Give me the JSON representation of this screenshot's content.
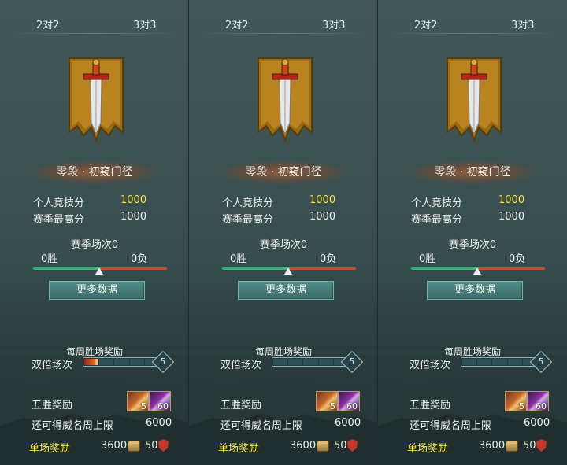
{
  "panels": [
    {
      "tabs": [
        "2对2",
        "3对3"
      ],
      "active_tab": 0,
      "rank": "零段 · 初窥门径",
      "personal_score_label": "个人竞技分",
      "personal_score": "1000",
      "season_high_label": "赛季最高分",
      "season_high": "1000",
      "season_matches": "赛季场次0",
      "wins": "0胜",
      "losses": "0负",
      "more_data": "更多数据",
      "weekly_reward": "每周胜场奖励",
      "double_label": "双倍场次",
      "double_count": "5",
      "double_filled": 1,
      "five_win_label": "五胜奖励",
      "reward_icon1_count": "5",
      "reward_icon2_count": "60",
      "cap_label": "还可得威名周上限",
      "cap_value": "6000",
      "single_label": "单场奖励",
      "single_value1": "3600",
      "single_value2": "50"
    },
    {
      "tabs": [
        "2对2",
        "3对3"
      ],
      "active_tab": 1,
      "rank": "零段 · 初窥门径",
      "personal_score_label": "个人竞技分",
      "personal_score": "1000",
      "season_high_label": "赛季最高分",
      "season_high": "1000",
      "season_matches": "赛季场次0",
      "wins": "0胜",
      "losses": "0负",
      "more_data": "更多数据",
      "weekly_reward": "每周胜场奖励",
      "double_label": "双倍场次",
      "double_count": "5",
      "double_filled": 0,
      "five_win_label": "五胜奖励",
      "reward_icon1_count": "5",
      "reward_icon2_count": "60",
      "cap_label": "还可得威名周上限",
      "cap_value": "6000",
      "single_label": "单场奖励",
      "single_value1": "3600",
      "single_value2": "50"
    },
    {
      "tabs": [
        "2对2",
        "3对3"
      ],
      "active_tab": 2,
      "rank": "零段 · 初窥门径",
      "personal_score_label": "个人竞技分",
      "personal_score": "1000",
      "season_high_label": "赛季最高分",
      "season_high": "1000",
      "season_matches": "赛季场次0",
      "wins": "0胜",
      "losses": "0负",
      "more_data": "更多数据",
      "weekly_reward": "每周胜场奖励",
      "double_label": "双倍场次",
      "double_count": "5",
      "double_filled": 0,
      "five_win_label": "五胜奖励",
      "reward_icon1_count": "5",
      "reward_icon2_count": "60",
      "cap_label": "还可得威名周上限",
      "cap_value": "6000",
      "single_label": "单场奖励",
      "single_value1": "3600",
      "single_value2": "50"
    }
  ],
  "icons": {
    "emblem": "sword-banner-icon",
    "reward1": "chest-reward-icon",
    "reward2": "purple-gem-icon",
    "coin": "coin-icon",
    "shield": "shield-icon",
    "marker": "progress-marker-icon"
  },
  "colors": {
    "highlight": "#f5e54a",
    "win_bar": "#3fae7a",
    "loss_bar": "#b05a33",
    "button": "#3d6f6b"
  }
}
